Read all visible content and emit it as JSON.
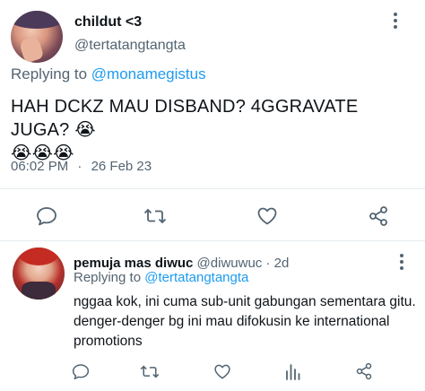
{
  "main_tweet": {
    "author_name": "childut <3",
    "author_handle": "@tertatangtangta",
    "replying_label": "Replying to ",
    "replying_to": "@monamegistus",
    "text_line1": "HAH DCKZ MAU DISBAND? 4GGRAVATE JUGA? 😭",
    "text_line2": "😭😭😭",
    "time": "06:02 PM",
    "dot": "·",
    "date": "26 Feb 23"
  },
  "reply_tweet": {
    "author_name": "pemuja mas diwuc",
    "author_handle": "@diwuwuc",
    "dot": "·",
    "age": "2d",
    "replying_label": "Replying to ",
    "replying_to": "@tertatangtangta",
    "text": "nggaa kok, ini cuma sub-unit gabungan sementara gitu. denger-denger bg ini mau difokusin ke international promotions"
  },
  "icons": {
    "reply": "comment-icon",
    "retweet": "retweet-icon",
    "like": "heart-icon",
    "share": "share-icon",
    "views": "analytics-icon",
    "more": "more-vertical-icon"
  },
  "colors": {
    "accent": "#1d9bf0",
    "secondary_text": "#536471",
    "primary_text": "#0f1419",
    "divider": "#e6ecf0"
  }
}
